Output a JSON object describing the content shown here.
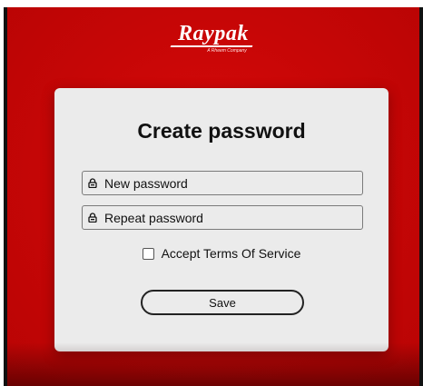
{
  "logo": {
    "brand": "Raypak",
    "tagline": "A Rheem Company"
  },
  "form": {
    "title": "Create password",
    "new_password_placeholder": "New password",
    "repeat_password_placeholder": "Repeat password",
    "terms_label": "Accept Terms Of Service",
    "terms_checked": false,
    "save_label": "Save"
  },
  "icons": {
    "field_icon": "lock-icon"
  },
  "colors": {
    "background": "#c60606",
    "card": "#ebebeb",
    "text": "#111111"
  }
}
